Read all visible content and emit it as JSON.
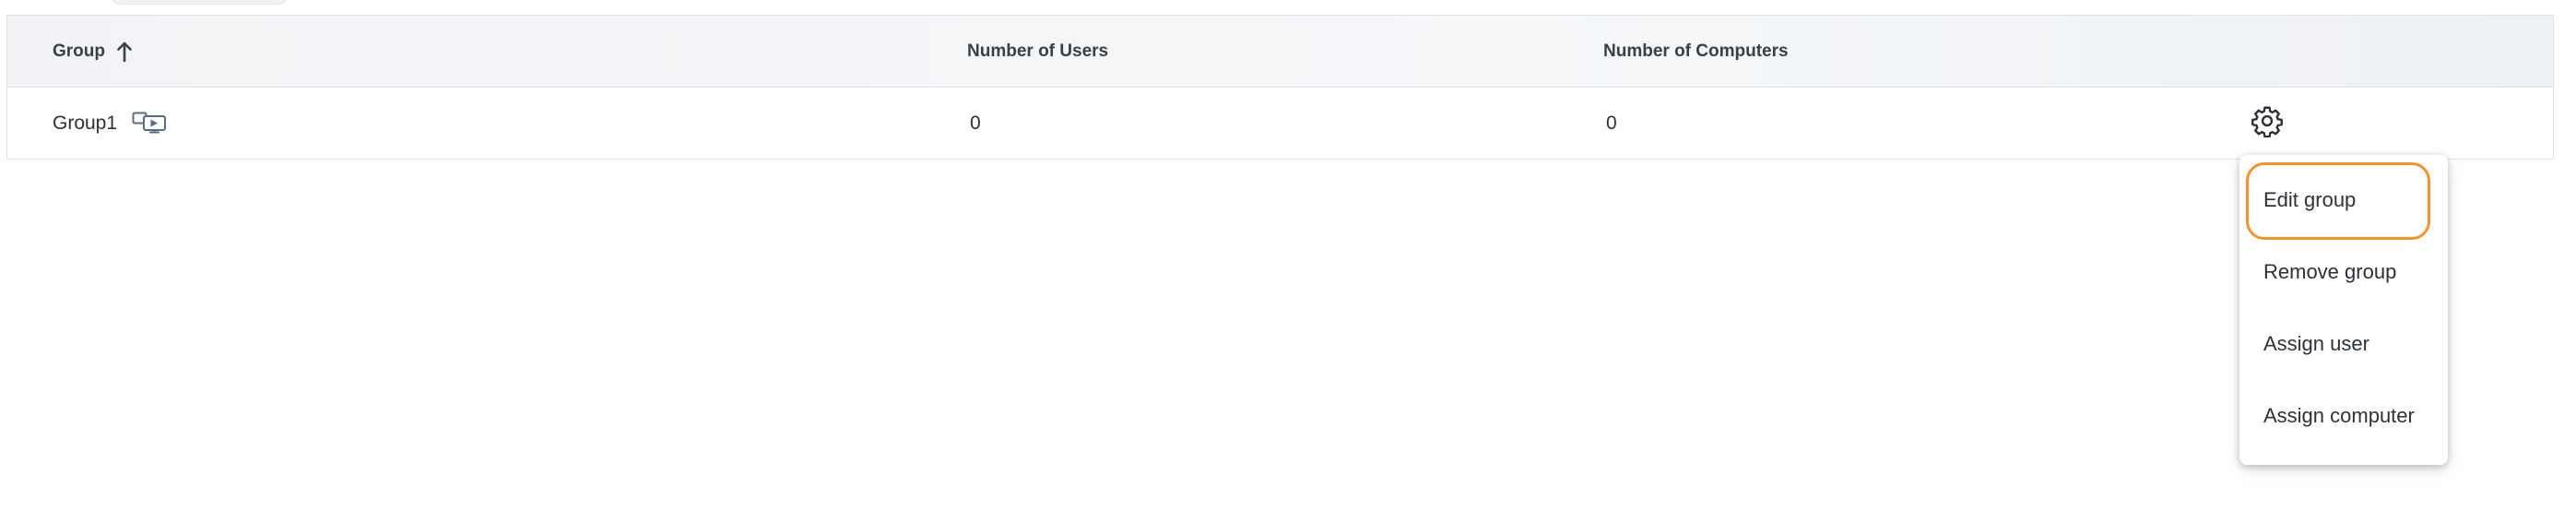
{
  "table": {
    "headers": {
      "group": "Group",
      "users": "Number of Users",
      "computers": "Number of Computers"
    },
    "sort": {
      "column": "group",
      "direction": "ascending"
    },
    "rows": [
      {
        "group": "Group1",
        "users": "0",
        "computers": "0",
        "group_icon": "remote-desktop-icon"
      }
    ]
  },
  "context_menu": {
    "trigger_icon": "gear-icon",
    "items": [
      {
        "label": "Edit group",
        "focused": true
      },
      {
        "label": "Remove group"
      },
      {
        "label": "Assign user"
      },
      {
        "label": "Assign computer"
      }
    ],
    "focus_color": "#f0942b"
  }
}
